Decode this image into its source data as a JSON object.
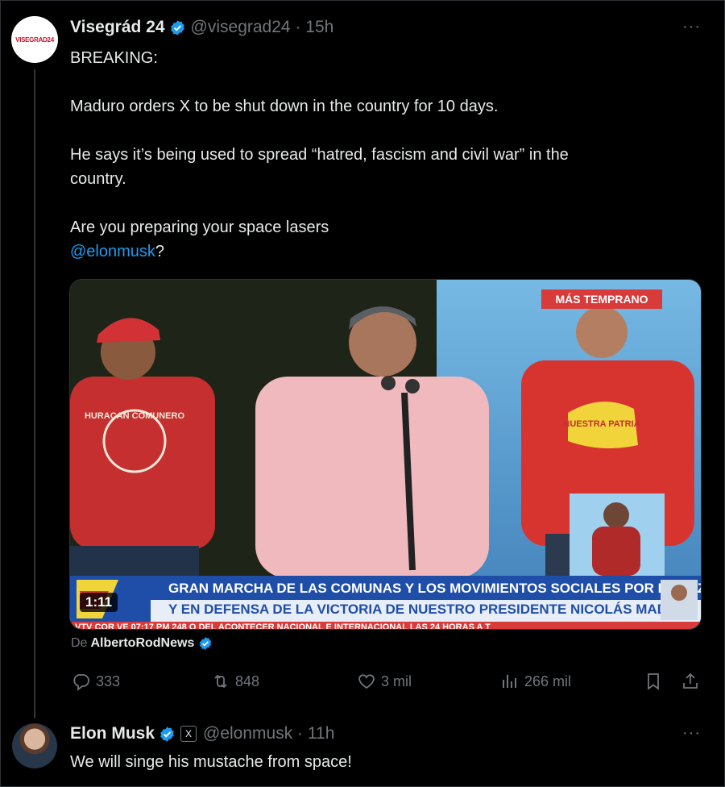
{
  "tweet1": {
    "author_name": "Visegrád 24",
    "handle": "@visegrad24",
    "time": "15h",
    "avatar_text": "VISEGRAD24",
    "lines": [
      "BREAKING:",
      "Maduro orders X to be shut down in the country for 10 days.",
      "He says it’s being used to spread “hatred, fascism and civil war” in the",
      "country.",
      "Are you preparing your space lasers"
    ],
    "mention": "@elonmusk",
    "after_mention": "?",
    "media": {
      "duration": "1:11",
      "tag_top": "MÁS TEMPRANO",
      "banner_line1": "GRAN MARCHA DE LAS COMUNAS Y LOS MOVIMIENTOS SOCIALES POR LA PAZ",
      "banner_line2": "Y EN DEFENSA DE LA VICTORIA DE NUESTRO PRESIDENTE NICOLÁS MADURO",
      "ticker": "VTV COR VE   07:17 PM      248      O DEL ACONTECER NACIONAL E INTERNACIONAL LAS 24 HORAS A T",
      "shirt_left": "HURACAN COMUNERO",
      "shirt_right": "NUESTRA PATRIA"
    },
    "from_prefix": "De",
    "from_source": "AlbertoRodNews",
    "actions": {
      "replies": "333",
      "reposts": "848",
      "likes": "3 mil",
      "views": "266 mil"
    }
  },
  "tweet2": {
    "author_name": "Elon Musk",
    "handle": "@elonmusk",
    "time": "11h",
    "text": "We will singe his mustache from space!",
    "badge": "X"
  },
  "colors": {
    "link": "#1d9bf0",
    "verified": "#1d9bf0",
    "muted": "#71767b",
    "bg": "#000000"
  }
}
